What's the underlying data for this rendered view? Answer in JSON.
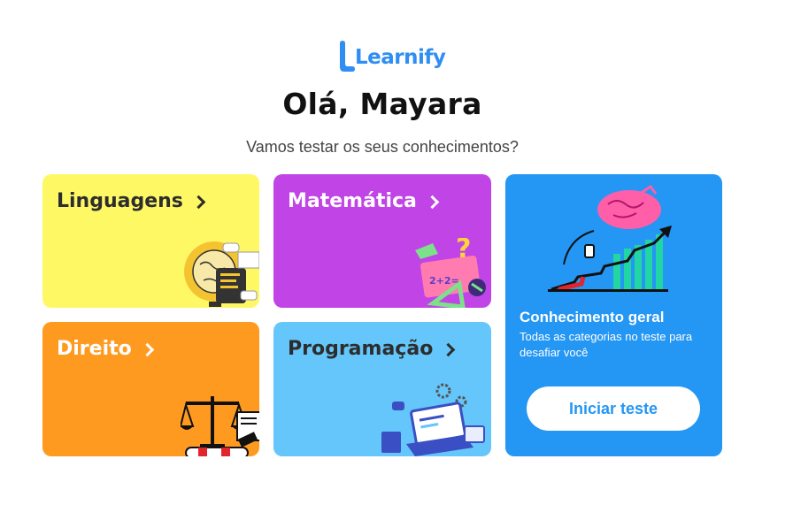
{
  "brand": {
    "name": "Learnify",
    "color": "#2f8ef3"
  },
  "greeting": "Olá, Mayara",
  "subtitle": "Vamos testar os seus conhecimentos?",
  "categories": [
    {
      "label": "Linguagens",
      "color": "#fff865",
      "icon": "globe-books-icon"
    },
    {
      "label": "Matemática",
      "color": "#c044e6",
      "icon": "math-shapes-icon"
    },
    {
      "label": "Direito",
      "color": "#ff9a21",
      "icon": "justice-scale-icon"
    },
    {
      "label": "Programação",
      "color": "#64c6fa",
      "icon": "laptop-code-icon"
    }
  ],
  "general": {
    "title": "Conhecimento geral",
    "description": "Todas as categorias no teste para desafiar você",
    "button_label": "Iniciar teste",
    "color": "#2496f4",
    "icon": "brain-growth-chart-icon"
  }
}
